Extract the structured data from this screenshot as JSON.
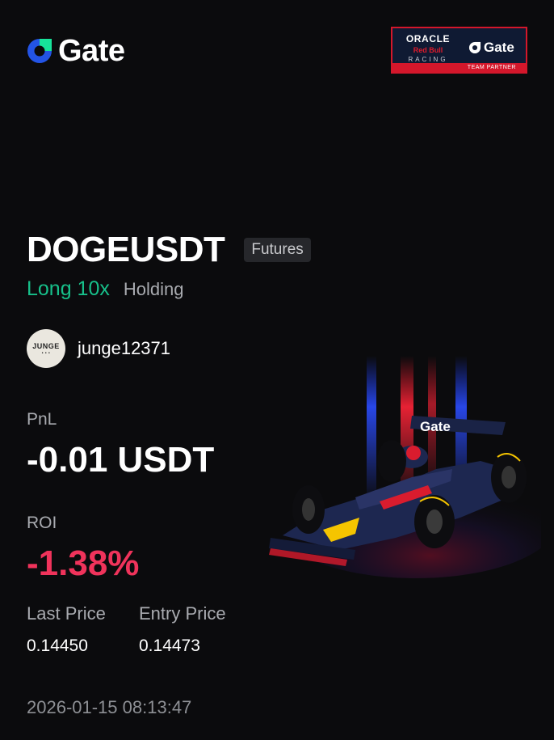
{
  "header": {
    "brand": "Gate",
    "partner": {
      "oracle": "ORACLE",
      "red_bull": "Red Bull",
      "racing": "RACING",
      "brand": "Gate",
      "tag": "TEAM PARTNER"
    }
  },
  "position": {
    "symbol": "DOGEUSDT",
    "type_badge": "Futures",
    "side": "Long 10x",
    "status": "Holding"
  },
  "user": {
    "avatar_text": "JUNGE",
    "username": "junge12371"
  },
  "pnl": {
    "label": "PnL",
    "value": "-0.01 USDT"
  },
  "roi": {
    "label": "ROI",
    "value": "-1.38%"
  },
  "prices": {
    "last_label": "Last Price",
    "last_value": "0.14450",
    "entry_label": "Entry Price",
    "entry_value": "0.14473"
  },
  "timestamp": "2026-01-15 08:13:47",
  "car_livery": {
    "text": "Gate"
  },
  "colors": {
    "background": "#0b0b0d",
    "long": "#17c08a",
    "roi_negative": "#f0335b",
    "gate_blue": "#2354e6",
    "gate_green": "#17e39a"
  }
}
